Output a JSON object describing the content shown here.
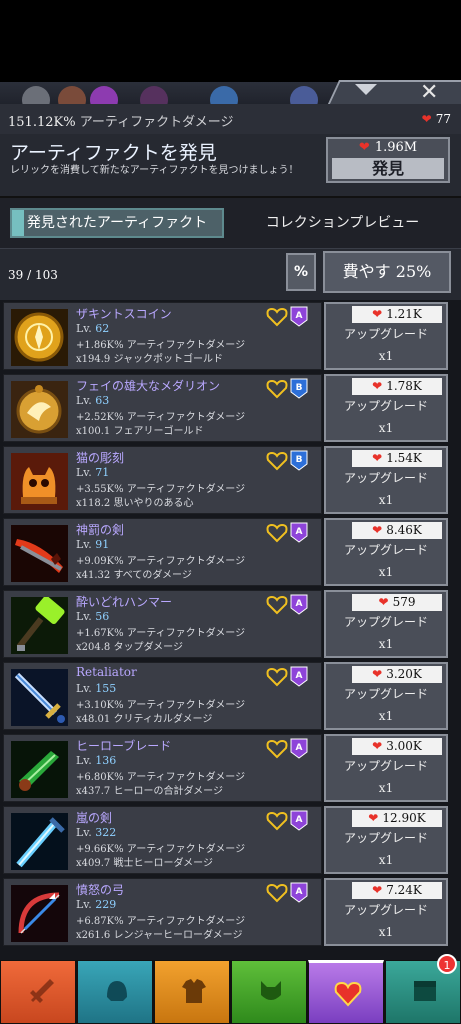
{
  "header": {
    "damage_value": "151.12K%",
    "damage_label": "アーティファクトダメージ",
    "relics": "77"
  },
  "discover": {
    "title": "アーティファクトを発見",
    "description": "レリックを消費して新たなアーティファクトを見つけましょう！",
    "cost": "1.96M",
    "button_label": "発見"
  },
  "tabs": {
    "found": "発見されたアーティファクト",
    "collection": "コレクションプレビュー"
  },
  "counts": {
    "artifacts": "39 / 103",
    "percent_label": "%",
    "spend_label": "費やす 25%"
  },
  "colors": {
    "relic": "#e8322a",
    "tier_a": "#8e44d9",
    "tier_b": "#2d6fd8",
    "name": "#b9a8ff"
  },
  "artifacts": [
    {
      "name": "ザキントスコイン",
      "level_label": "Lv.",
      "level": "62",
      "bonus1": "+1.86K% アーティファクトダメージ",
      "bonus2": "x194.9 ジャックポットゴールド",
      "tier": "A",
      "cost": "1.21K",
      "upgrade_label": "アップグレード",
      "mult": "x1",
      "icon": "coin-icon"
    },
    {
      "name": "フェイの雄大なメダリオン",
      "level_label": "Lv.",
      "level": "63",
      "bonus1": "+2.52K% アーティファクトダメージ",
      "bonus2": "x100.1 フェアリーゴールド",
      "tier": "B",
      "cost": "1.78K",
      "upgrade_label": "アップグレード",
      "mult": "x1",
      "icon": "medallion-icon"
    },
    {
      "name": "猫の彫刻",
      "level_label": "Lv.",
      "level": "71",
      "bonus1": "+3.55K% アーティファクトダメージ",
      "bonus2": "x118.2 思いやりのある心",
      "tier": "B",
      "cost": "1.54K",
      "upgrade_label": "アップグレード",
      "mult": "x1",
      "icon": "cat-statue-icon"
    },
    {
      "name": "神罰の剣",
      "level_label": "Lv.",
      "level": "91",
      "bonus1": "+9.09K% アーティファクトダメージ",
      "bonus2": "x41.32 すべてのダメージ",
      "tier": "A",
      "cost": "8.46K",
      "upgrade_label": "アップグレード",
      "mult": "x1",
      "icon": "flame-sword-icon"
    },
    {
      "name": "酔いどれハンマー",
      "level_label": "Lv.",
      "level": "56",
      "bonus1": "+1.67K% アーティファクトダメージ",
      "bonus2": "x204.8 タップダメージ",
      "tier": "A",
      "cost": "579",
      "upgrade_label": "アップグレード",
      "mult": "x1",
      "icon": "hammer-icon"
    },
    {
      "name": "Retaliator",
      "level_label": "Lv.",
      "level": "155",
      "bonus1": "+3.10K% アーティファクトダメージ",
      "bonus2": "x48.01 クリティカルダメージ",
      "tier": "A",
      "cost": "3.20K",
      "upgrade_label": "アップグレード",
      "mult": "x1",
      "icon": "blue-sword-icon"
    },
    {
      "name": "ヒーローブレード",
      "level_label": "Lv.",
      "level": "136",
      "bonus1": "+6.80K% アーティファクトダメージ",
      "bonus2": "x437.7 ヒーローの合計ダメージ",
      "tier": "A",
      "cost": "3.00K",
      "upgrade_label": "アップグレード",
      "mult": "x1",
      "icon": "green-blade-icon"
    },
    {
      "name": "嵐の剣",
      "level_label": "Lv.",
      "level": "322",
      "bonus1": "+9.66K% アーティファクトダメージ",
      "bonus2": "x409.7 戦士ヒーローダメージ",
      "tier": "A",
      "cost": "12.90K",
      "upgrade_label": "アップグレード",
      "mult": "x1",
      "icon": "storm-sword-icon"
    },
    {
      "name": "憤怒の弓",
      "level_label": "Lv.",
      "level": "229",
      "bonus1": "+6.87K% アーティファクトダメージ",
      "bonus2": "x261.6 レンジャーヒーローダメージ",
      "tier": "A",
      "cost": "7.24K",
      "upgrade_label": "アップグレード",
      "mult": "x1",
      "icon": "bow-icon"
    }
  ],
  "bottom_nav": {
    "tabs": [
      "sword-icon",
      "helmet-icon",
      "armor-icon",
      "pet-icon",
      "artifact-heart-icon",
      "shop-chest-icon"
    ],
    "badge": "1"
  }
}
